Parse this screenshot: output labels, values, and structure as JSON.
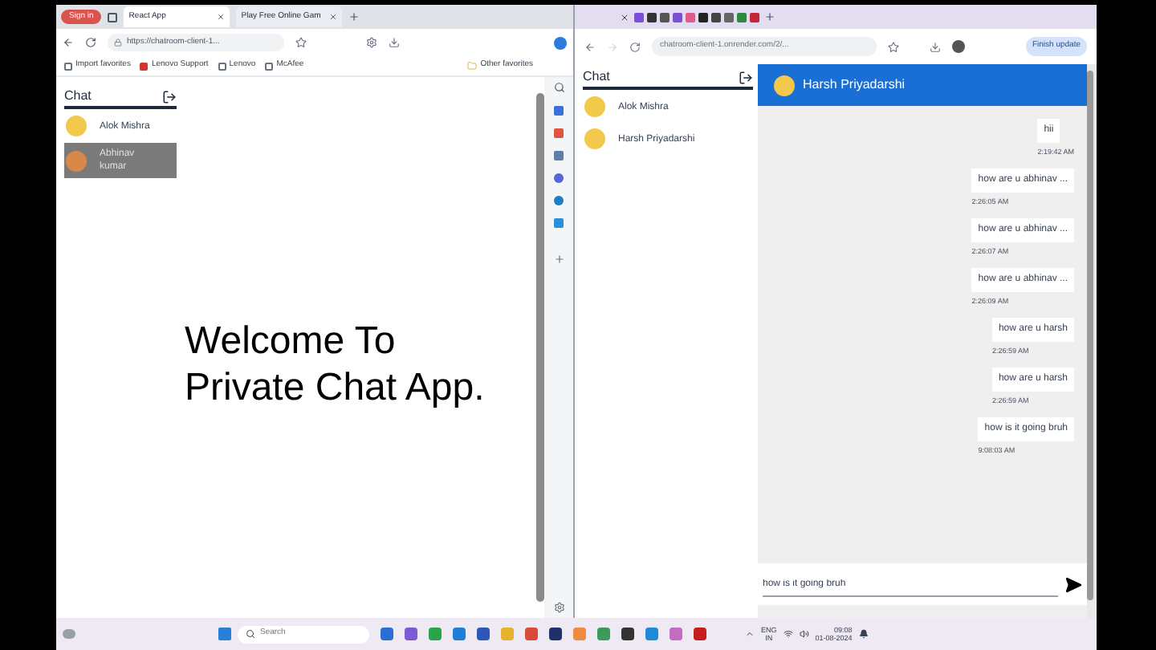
{
  "left_browser": {
    "profile": "Sign in",
    "tabs": [
      {
        "label": "React App",
        "selected": true
      },
      {
        "label": "Play Free Online Gam",
        "selected": false
      }
    ],
    "address": "https://chatroom-client-1...",
    "favorites": [
      "Import favorites",
      "Lenovo Support",
      "Lenovo",
      "McAfee"
    ],
    "other_favorites": "Other favorites",
    "app": {
      "sidebar_title": "Chat",
      "users": [
        {
          "name": "Alok Mishra",
          "selected": false
        },
        {
          "name": "Abhinav kumar",
          "selected": true
        }
      ],
      "welcome_lines": [
        "Welcome To",
        "Private Chat App."
      ]
    }
  },
  "right_browser": {
    "address": "chatroom-client-1.onrender.com/2/...",
    "update_button": "Finish update",
    "app": {
      "sidebar_title": "Chat",
      "users": [
        {
          "name": "Alok Mishra",
          "selected": false
        },
        {
          "name": "Harsh Priyadarshi",
          "selected": false
        }
      ],
      "chat_header": "Harsh Priyadarshi",
      "messages": [
        {
          "text": "hii",
          "time": "2:19:42 AM"
        },
        {
          "text": "how are u abhinav ...",
          "time": "2:26:05 AM"
        },
        {
          "text": "how are u abhinav ...",
          "time": "2:26:07 AM"
        },
        {
          "text": "how are u abhinav ...",
          "time": "2:26:09 AM"
        },
        {
          "text": "how are u harsh",
          "time": "2:26:59 AM"
        },
        {
          "text": "how are u harsh",
          "time": "2:26:59 AM"
        },
        {
          "text": "how is it going bruh",
          "time": "9:08:03 AM"
        }
      ],
      "input_value": "how is it going bruh"
    }
  },
  "taskbar": {
    "search_placeholder": "Search",
    "language": "ENG",
    "region": "IN",
    "time": "09:08",
    "date": "01-08-2024"
  }
}
